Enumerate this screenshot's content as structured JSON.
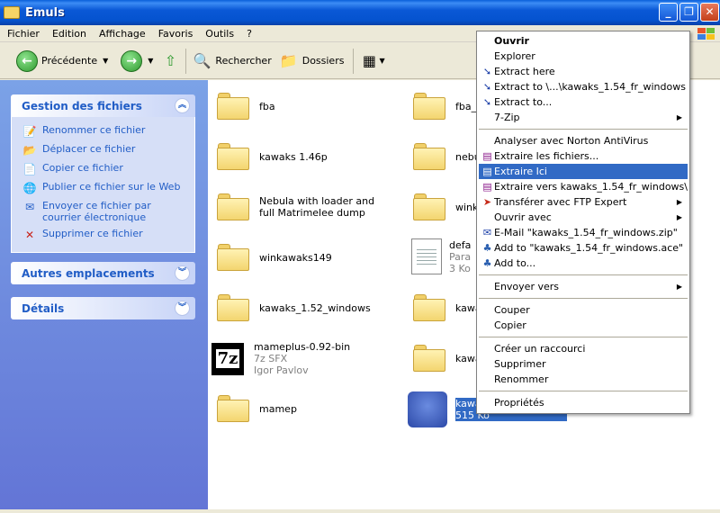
{
  "window": {
    "title": "Emuls"
  },
  "menubar": [
    "Fichier",
    "Edition",
    "Affichage",
    "Favoris",
    "Outils",
    "?"
  ],
  "toolbar": {
    "back": "Précédente",
    "search": "Rechercher",
    "folders": "Dossiers"
  },
  "tasks_panel": {
    "title": "Gestion des fichiers",
    "items": [
      "Renommer ce fichier",
      "Déplacer ce fichier",
      "Copier ce fichier",
      "Publier ce fichier sur le Web",
      "Envoyer ce fichier par courrier électronique",
      "Supprimer ce fichier"
    ]
  },
  "other_places": {
    "title": "Autres emplacements"
  },
  "details": {
    "title": "Détails"
  },
  "files": {
    "left": [
      {
        "name": "fba"
      },
      {
        "name": "kawaks 1.46p"
      },
      {
        "name": "Nebula with loader and full Matrimelee dump"
      },
      {
        "name": "winkawaks149"
      },
      {
        "name": "kawaks_1.52_windows"
      },
      {
        "name": "mameplus-0.92-bin",
        "line2": "7z SFX",
        "line3": "Igor Pavlov"
      },
      {
        "name": "mamep"
      }
    ],
    "right": [
      {
        "name": "fba_"
      },
      {
        "name": "nebu"
      },
      {
        "name": "wink"
      },
      {
        "name": "defa",
        "line2": "Para",
        "line3": "3 Ko"
      },
      {
        "name": "kawa"
      },
      {
        "name": "kawa"
      },
      {
        "name": "kawa",
        "line2": "515 Ko"
      }
    ]
  },
  "context_menu": {
    "items": [
      {
        "label": "Ouvrir",
        "bold": true
      },
      {
        "label": "Explorer"
      },
      {
        "label": "Extract here",
        "icon": "arrow-down-icon"
      },
      {
        "label": "Extract to \\...\\kawaks_1.54_fr_windows",
        "icon": "arrow-down-icon"
      },
      {
        "label": "Extract to...",
        "icon": "arrow-down-icon"
      },
      {
        "label": "7-Zip",
        "submenu": true
      },
      {
        "label": "Analyser avec Norton AntiVirus"
      },
      {
        "label": "Extraire les fichiers...",
        "icon": "rar-icon"
      },
      {
        "label": "Extraire Ici",
        "icon": "rar-icon",
        "highlight": true
      },
      {
        "label": "Extraire vers kawaks_1.54_fr_windows\\",
        "icon": "rar-icon"
      },
      {
        "label": "Transférer avec FTP Expert",
        "icon": "ftp-icon",
        "submenu": true
      },
      {
        "label": "Ouvrir avec",
        "submenu": true
      },
      {
        "label": "E-Mail \"kawaks_1.54_fr_windows.zip\"",
        "icon": "mail-icon"
      },
      {
        "label": "Add to \"kawaks_1.54_fr_windows.ace\"",
        "icon": "ace-icon"
      },
      {
        "label": "Add to...",
        "icon": "ace-icon"
      },
      {
        "label": "Envoyer vers",
        "submenu": true
      },
      {
        "label": "Couper"
      },
      {
        "label": "Copier"
      },
      {
        "label": "Créer un raccourci"
      },
      {
        "label": "Supprimer"
      },
      {
        "label": "Renommer"
      },
      {
        "label": "Propriétés"
      }
    ]
  },
  "colors": {
    "title_bar": "#0553cf",
    "selection": "#316ac5",
    "task_pane": "#6375d6",
    "task_link": "#215dc6"
  }
}
